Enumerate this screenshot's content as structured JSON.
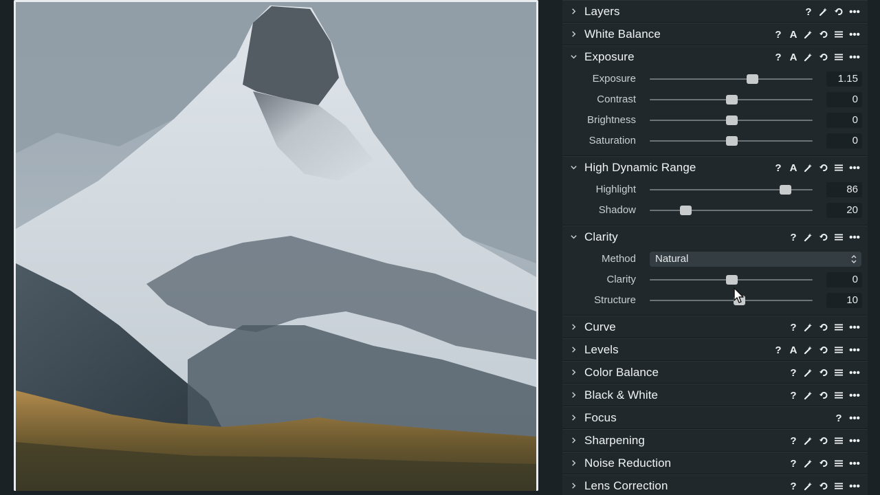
{
  "panel": {
    "tools": [
      {
        "name": "Layers",
        "expanded": false,
        "icons": [
          "help",
          "wand",
          "reset",
          "more"
        ]
      },
      {
        "name": "White Balance",
        "expanded": false,
        "icons": [
          "help",
          "auto",
          "wand",
          "reset",
          "menu",
          "more"
        ]
      },
      {
        "name": "Exposure",
        "expanded": true,
        "icons": [
          "help",
          "auto",
          "wand",
          "reset",
          "menu",
          "more"
        ],
        "controls": [
          {
            "type": "slider",
            "label": "Exposure",
            "value": "1.15",
            "fraction": 0.63
          },
          {
            "type": "slider",
            "label": "Contrast",
            "value": "0",
            "fraction": 0.5
          },
          {
            "type": "slider",
            "label": "Brightness",
            "value": "0",
            "fraction": 0.5
          },
          {
            "type": "slider",
            "label": "Saturation",
            "value": "0",
            "fraction": 0.5
          }
        ]
      },
      {
        "name": "High Dynamic Range",
        "expanded": true,
        "icons": [
          "help",
          "auto",
          "wand",
          "reset",
          "menu",
          "more"
        ],
        "controls": [
          {
            "type": "slider",
            "label": "Highlight",
            "value": "86",
            "fraction": 0.83
          },
          {
            "type": "slider",
            "label": "Shadow",
            "value": "20",
            "fraction": 0.22
          }
        ]
      },
      {
        "name": "Clarity",
        "expanded": true,
        "icons": [
          "help",
          "wand",
          "reset",
          "menu",
          "more"
        ],
        "controls": [
          {
            "type": "select",
            "label": "Method",
            "value": "Natural"
          },
          {
            "type": "slider",
            "label": "Clarity",
            "value": "0",
            "fraction": 0.5
          },
          {
            "type": "slider",
            "label": "Structure",
            "value": "10",
            "fraction": 0.55
          }
        ]
      },
      {
        "name": "Curve",
        "expanded": false,
        "icons": [
          "help",
          "wand",
          "reset",
          "menu",
          "more"
        ]
      },
      {
        "name": "Levels",
        "expanded": false,
        "icons": [
          "help",
          "auto",
          "wand",
          "reset",
          "menu",
          "more"
        ]
      },
      {
        "name": "Color Balance",
        "expanded": false,
        "icons": [
          "help",
          "wand",
          "reset",
          "menu",
          "more"
        ]
      },
      {
        "name": "Black & White",
        "expanded": false,
        "icons": [
          "help",
          "wand",
          "reset",
          "menu",
          "more"
        ]
      },
      {
        "name": "Focus",
        "expanded": false,
        "icons": [
          "help",
          "more"
        ]
      },
      {
        "name": "Sharpening",
        "expanded": false,
        "icons": [
          "help",
          "wand",
          "reset",
          "menu",
          "more"
        ]
      },
      {
        "name": "Noise Reduction",
        "expanded": false,
        "icons": [
          "help",
          "wand",
          "reset",
          "menu",
          "more"
        ]
      },
      {
        "name": "Lens Correction",
        "expanded": false,
        "icons": [
          "help",
          "wand",
          "reset",
          "menu",
          "more"
        ]
      }
    ]
  },
  "glyphs": {
    "help": "?",
    "auto": "A",
    "more": "•••"
  },
  "colors": {
    "panel_bg": "#1e2529",
    "tool_bg": "#20282c",
    "slider_knob": "#c8cbcc",
    "value_box": "#1a2124"
  }
}
